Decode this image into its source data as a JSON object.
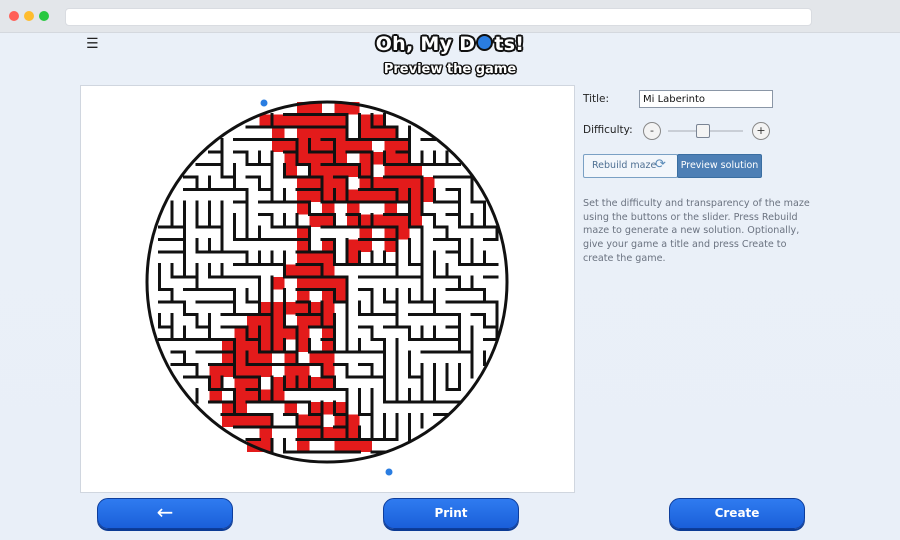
{
  "app": {
    "logo_text_1": "Oh, My D",
    "logo_text_2": "ts!",
    "subtitle": "Preview the game",
    "menu_icon": "hamburger-icon"
  },
  "form": {
    "title_label": "Title:",
    "title_value": "Mi Laberinto",
    "difficulty_label": "Difficulty:",
    "difficulty_minus": "-",
    "difficulty_plus": "+",
    "difficulty_level": 0.45,
    "rebuild_label": "Rebuild maze",
    "rebuild_icon": "refresh-icon",
    "preview_label": "Preview solution",
    "help_text": "Set the difficulty and transparency of the maze using the buttons or the slider. Press Rebuild maze to generate a new solution. Optionally, give your game a title and press Create to create the game."
  },
  "footer": {
    "back_icon": "arrow-left-icon",
    "back_glyph": "←",
    "print_label": "Print",
    "create_label": "Create"
  },
  "colors": {
    "maze_wall": "#111111",
    "solution_path": "#e31b1b",
    "button_blue": "#1f66e0",
    "marker": "#2a7de1"
  }
}
